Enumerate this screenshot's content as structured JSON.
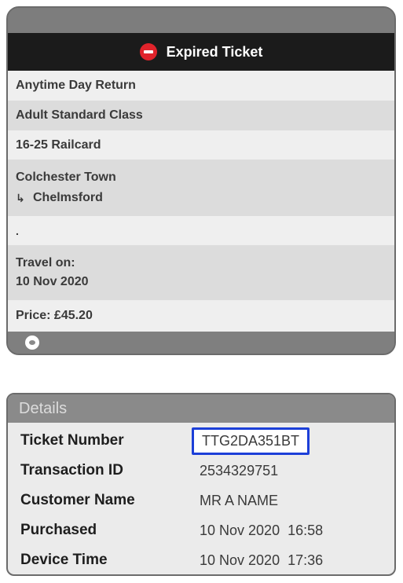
{
  "ticket": {
    "status_label": "Expired Ticket",
    "status_icon": "no-entry-icon",
    "status_icon_color": "#e0232b",
    "ticket_type": "Anytime Day Return",
    "ticket_class": "Adult Standard Class",
    "railcard": "16-25 Railcard",
    "origin": "Colchester Town",
    "destination_arrow": "↳",
    "destination": "Chelmsford",
    "blank_row": ".",
    "travel_on_label": "Travel on:",
    "travel_date": "10 Nov 2020",
    "price": "Price: £45.20",
    "footer_icon": "eye-icon"
  },
  "details": {
    "title": "Details",
    "highlight_color": "#1c3fd8",
    "rows": [
      {
        "label": "Ticket Number",
        "value": "TTG2DA351BT"
      },
      {
        "label": "Transaction ID",
        "value": "2534329751"
      },
      {
        "label": "Customer Name",
        "value": "MR A NAME"
      },
      {
        "label": "Purchased",
        "value": "10 Nov 2020  16:58"
      },
      {
        "label": "Device Time",
        "value": "10 Nov 2020  17:36"
      }
    ]
  }
}
